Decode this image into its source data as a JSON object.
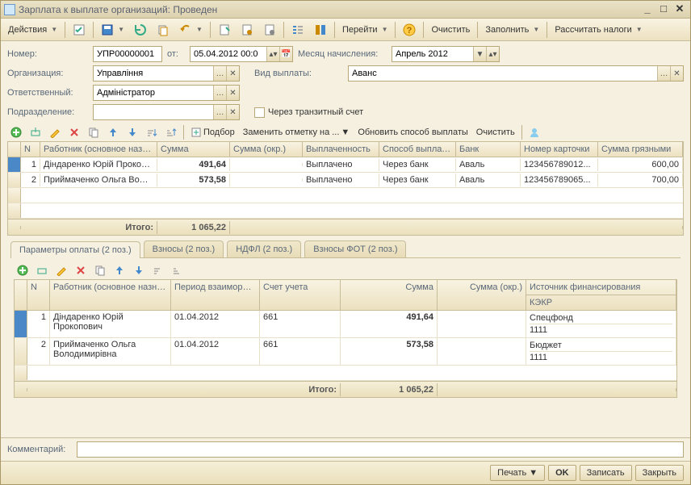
{
  "window": {
    "title": "Зарплата к выплате организаций: Проведен"
  },
  "toolbar": {
    "actions": "Действия",
    "goto": "Перейти",
    "clear": "Очистить",
    "fill": "Заполнить",
    "calc_taxes": "Рассчитать налоги"
  },
  "form": {
    "number_label": "Номер:",
    "number": "УПР00000001",
    "date_label": "от:",
    "date": "05.04.2012 00:0",
    "month_label": "Месяц начисления:",
    "month": "Апрель 2012",
    "org_label": "Организация:",
    "org": "Управління",
    "paytype_label": "Вид выплаты:",
    "paytype": "Аванс",
    "responsible_label": "Ответственный:",
    "responsible": "Адміністратор",
    "division_label": "Подразделение:",
    "division": "",
    "transit_label": "Через транзитный счет"
  },
  "grid1": {
    "toolbar": {
      "pick": "Подбор",
      "replace": "Заменить отметку на ...",
      "refresh": "Обновить способ выплаты",
      "clear": "Очистить"
    },
    "headers": {
      "n": "N",
      "worker": "Работник (основное назн...",
      "sum": "Сумма",
      "sum_r": "Сумма (окр.)",
      "paid": "Выплаченность",
      "method": "Способ выплаты",
      "bank": "Банк",
      "card": "Номер карточки",
      "gross": "Сумма грязными"
    },
    "rows": [
      {
        "n": "1",
        "worker": "Діндаренко Юрій Прокоп...",
        "sum": "491,64",
        "paid": "Выплачено",
        "method": "Через банк",
        "bank": "Аваль",
        "card": "123456789012...",
        "gross": "600,00"
      },
      {
        "n": "2",
        "worker": "Приймаченко Ольга Воло...",
        "sum": "573,58",
        "paid": "Выплачено",
        "method": "Через банк",
        "bank": "Аваль",
        "card": "123456789065...",
        "gross": "700,00"
      }
    ],
    "total_label": "Итого:",
    "total": "1 065,22"
  },
  "tabs": {
    "t1": "Параметры оплаты (2 поз.)",
    "t2": "Взносы (2 поз.)",
    "t3": "НДФЛ (2 поз.)",
    "t4": "Взносы ФОТ (2 поз.)"
  },
  "grid2": {
    "headers": {
      "n": "N",
      "worker": "Работник (основное назначение)",
      "period": "Период взаиморасчетов",
      "account": "Счет учета",
      "sum": "Сумма",
      "sum_r": "Сумма (окр.)",
      "source": "Источник финансирования",
      "kekr": "КЭКР"
    },
    "rows": [
      {
        "n": "1",
        "worker": "Діндаренко Юрій Прокопович",
        "period": "01.04.2012",
        "account": "661",
        "sum": "491,64",
        "source": "Спецфонд",
        "kekr": "1111"
      },
      {
        "n": "2",
        "worker": "Приймаченко Ольга Володимирівна",
        "period": "01.04.2012",
        "account": "661",
        "sum": "573,58",
        "source": "Бюджет",
        "kekr": "1111"
      }
    ],
    "total_label": "Итого:",
    "total": "1 065,22"
  },
  "comment_label": "Комментарий:",
  "footer": {
    "print": "Печать",
    "ok": "OK",
    "save": "Записать",
    "close": "Закрыть"
  }
}
